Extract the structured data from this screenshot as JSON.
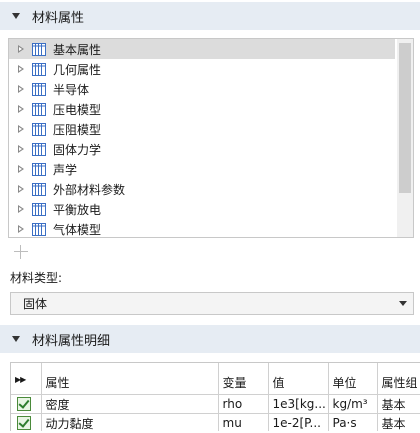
{
  "section_material_properties": {
    "title": "材料属性"
  },
  "tree": {
    "items": [
      {
        "label": "基本属性"
      },
      {
        "label": "几何属性"
      },
      {
        "label": "半导体"
      },
      {
        "label": "压电模型"
      },
      {
        "label": "压阻模型"
      },
      {
        "label": "固体力学"
      },
      {
        "label": "声学"
      },
      {
        "label": "外部材料参数"
      },
      {
        "label": "平衡放电"
      },
      {
        "label": "气体模型"
      }
    ],
    "selected_index": 0
  },
  "material_type": {
    "label": "材料类型:",
    "value": "固体"
  },
  "section_details": {
    "title": "材料属性明细"
  },
  "table": {
    "columns": [
      "",
      "属性",
      "变量",
      "值",
      "单位",
      "属性组"
    ],
    "rows": [
      {
        "checked": true,
        "property": "密度",
        "variable": "rho",
        "value": "1e3[kg...",
        "unit": "kg/m³",
        "group": "基本"
      },
      {
        "checked": true,
        "property": "动力黏度",
        "variable": "mu",
        "value": "1e-2[P...",
        "unit": "Pa·s",
        "group": "基本"
      }
    ]
  },
  "colors": {
    "header_bg": "#e6ecf3",
    "icon_blue": "#3b6fc4",
    "check_green": "#2e7d2e"
  }
}
